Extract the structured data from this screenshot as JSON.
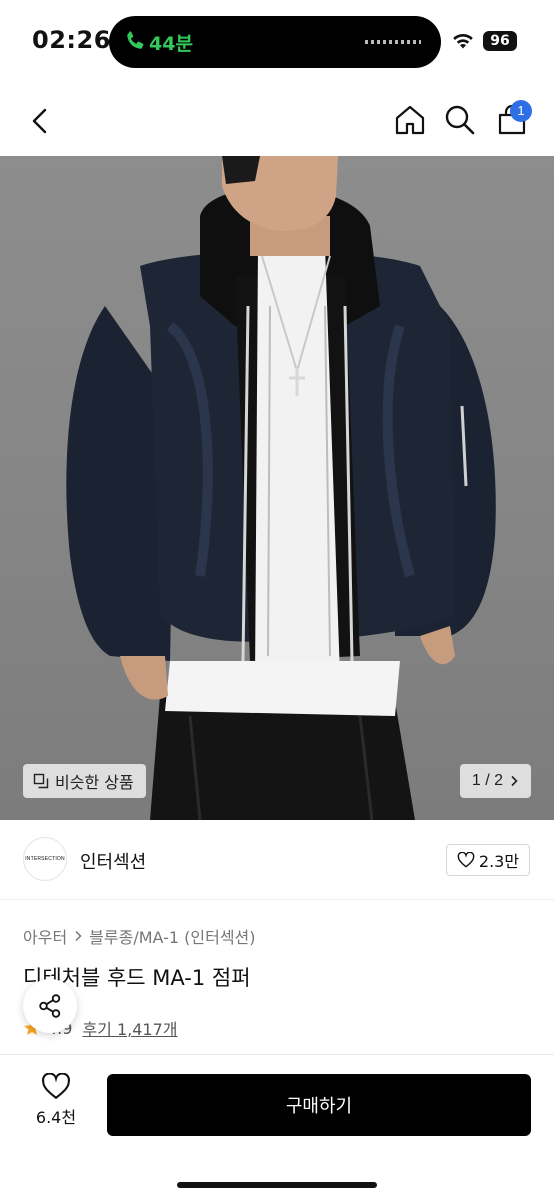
{
  "status_bar": {
    "time": "02:26",
    "call_text": "44분",
    "battery": "96",
    "icons": {
      "call": "phone-icon",
      "wifi": "wifi-icon"
    }
  },
  "nav": {
    "icons": [
      "back-chevron-icon",
      "home-icon",
      "search-icon",
      "cart-icon"
    ],
    "cart_badge": "1"
  },
  "hero": {
    "similar_label": "비슷한 상품",
    "pager": "1 / 2"
  },
  "brand": {
    "logo_text": "INTERSECTION",
    "name": "인터섹션",
    "likes": "2.3만"
  },
  "product": {
    "breadcrumb": [
      "아우터",
      "블루종/MA-1 (인터섹션)"
    ],
    "title": "디테처블 후드 MA-1 점퍼",
    "rating": "4.9",
    "review_text": "후기 1,417개"
  },
  "bottom": {
    "wish_count": "6.4천",
    "buy_label": "구매하기"
  },
  "colors": {
    "accent_badge": "#2f6fe6",
    "call_green": "#34c759",
    "star": "#f5a623",
    "buy_button": "#000000"
  }
}
